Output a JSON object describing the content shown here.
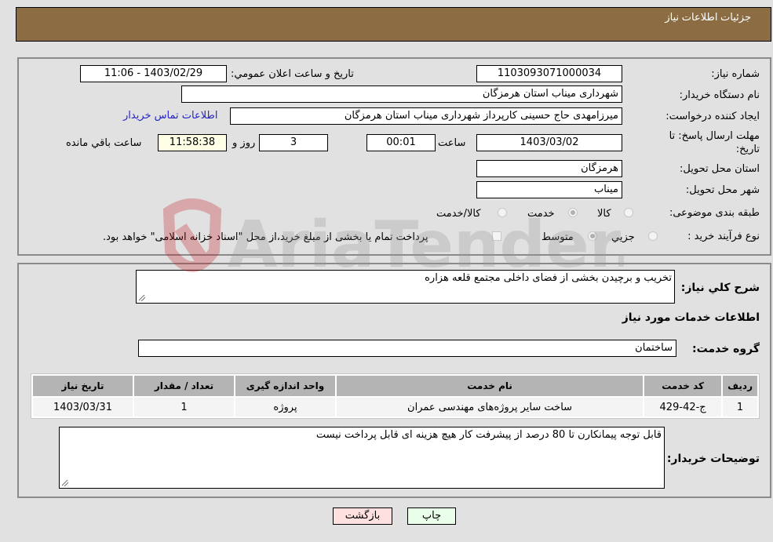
{
  "header": {
    "title": "جزئیات اطلاعات نیاز"
  },
  "fields": {
    "need_number_label": "شماره نیاز:",
    "need_number": "1103093071000034",
    "announce_label": "تاریخ و ساعت اعلان عمومي:",
    "announce_value": "1403/02/29 - 11:06",
    "buyer_org_label": "نام دستگاه خریدار:",
    "buyer_org": "شهرداری میناب استان هرمزگان",
    "creator_label": "ایجاد کننده درخواست:",
    "creator": "میرزامهدی حاج حسینی کارپرداز شهرداری میناب استان هرمزگان",
    "buyer_contact_link": "اطلاعات تماس خریدار",
    "deadline_label_1": "مهلت ارسال پاسخ: تا",
    "deadline_label_2": "تاریخ:",
    "deadline_date": "1403/03/02",
    "time_label": "ساعت",
    "deadline_time": "00:01",
    "days_value": "3",
    "days_label": "روز و",
    "remaining_time": "11:58:38",
    "remaining_label": "ساعت باقي مانده",
    "province_label": "استان محل تحویل:",
    "province": "هرمزگان",
    "city_label": "شهر محل تحویل:",
    "city": "میناب",
    "category_label": "طبقه بندی موضوعی:",
    "category_options": [
      {
        "label": "کالا",
        "checked": false
      },
      {
        "label": "خدمت",
        "checked": true
      },
      {
        "label": "کالا/خدمت",
        "checked": false
      }
    ],
    "process_label": "نوع فرآیند خرید :",
    "process_options": [
      {
        "label": "جزيي",
        "checked": false
      },
      {
        "label": "متوسط",
        "checked": true
      }
    ],
    "treasury_checkbox_label": "پرداخت تمام یا بخشی از مبلغ خرید،از محل \"اسناد خزانه اسلامی\" خواهد بود."
  },
  "details": {
    "summary_label": "شرح کلي نیاز:",
    "summary": "تخریب و برچیدن بخشی از فضای داخلی مجتمع قلعه هزاره",
    "services_heading": "اطلاعات خدمات مورد نیاز",
    "service_group_label": "گروه خدمت:",
    "service_group": "ساختمان",
    "table": {
      "headers": [
        "ردیف",
        "کد خدمت",
        "نام خدمت",
        "واحد اندازه گیری",
        "تعداد / مقدار",
        "تاریخ نیاز"
      ],
      "rows": [
        [
          "1",
          "ج-42-429",
          "ساخت سایر پروژه‌های مهندسی عمران",
          "پروژه",
          "1",
          "1403/03/31"
        ]
      ]
    },
    "buyer_notes_label": "توضیحات خریدار:",
    "buyer_notes": "قابل توجه پیمانکارن تا 80 درصد از پیشرفت کار  هیچ هزینه ای قابل پرداخت نیست"
  },
  "buttons": {
    "print": "چاپ",
    "back": "بازگشت"
  },
  "watermark": {
    "text": "AriaTender.neT"
  },
  "colors": {
    "header_bg": "#8c6d43",
    "print_bg": "#eaffea",
    "back_bg": "#ffe0e0",
    "remaining_bg": "#ffffe6",
    "link": "#2424c8"
  }
}
